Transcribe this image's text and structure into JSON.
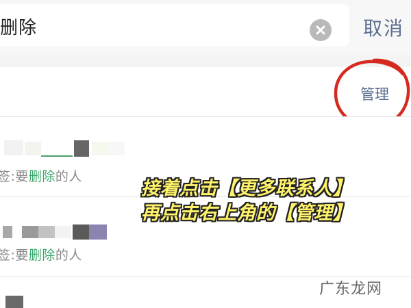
{
  "search": {
    "query": "删除",
    "cancel_label": "取消"
  },
  "header": {
    "manage_label": "管理"
  },
  "results": [
    {
      "tag_prefix": "签:要",
      "tag_highlight": "删除",
      "tag_suffix": "的人"
    },
    {
      "tag_prefix": "签:要",
      "tag_highlight": "删除",
      "tag_suffix": "的人"
    }
  ],
  "overlay": {
    "line1": "接着点击【更多联系人】",
    "line2": "再点击右上角的【管理】"
  },
  "watermark": "广东龙网",
  "colors": {
    "highlight": "#3aa66a",
    "link": "#5c6f8f",
    "annotation_circle": "#d42a1f",
    "overlay_text": "#fff36a"
  },
  "icons": {
    "clear": "clear-circle-x-icon"
  }
}
